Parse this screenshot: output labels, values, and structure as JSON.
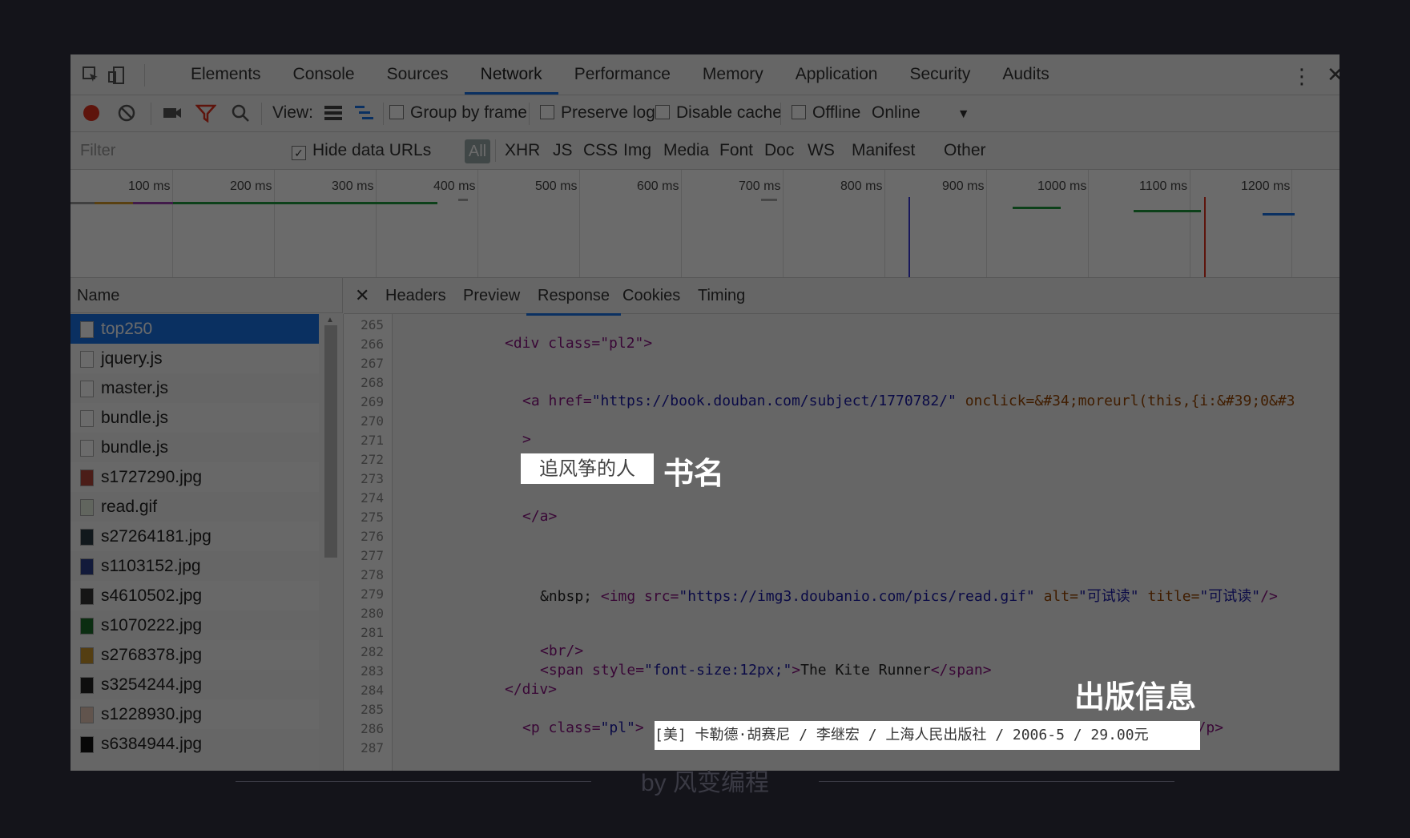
{
  "tabs": [
    "Elements",
    "Console",
    "Sources",
    "Network",
    "Performance",
    "Memory",
    "Application",
    "Security",
    "Audits"
  ],
  "toolbar": {
    "view": "View:",
    "group_by_frame": "Group by frame",
    "preserve_log": "Preserve log",
    "disable_cache": "Disable cache",
    "offline": "Offline",
    "online": "Online"
  },
  "filterbar": {
    "filter_placeholder": "Filter",
    "hide_data_urls": "Hide data URLs",
    "all": "All",
    "types": [
      "XHR",
      "JS",
      "CSS",
      "Img",
      "Media",
      "Font",
      "Doc",
      "WS",
      "Manifest",
      "Other"
    ]
  },
  "timeline": {
    "ticks": [
      "100 ms",
      "200 ms",
      "300 ms",
      "400 ms",
      "500 ms",
      "600 ms",
      "700 ms",
      "800 ms",
      "900 ms",
      "1000 ms",
      "1100 ms",
      "1200 ms"
    ]
  },
  "requests": {
    "header": "Name",
    "items": [
      "top250",
      "jquery.js",
      "master.js",
      "bundle.js",
      "bundle.js",
      "s1727290.jpg",
      "read.gif",
      "s27264181.jpg",
      "s1103152.jpg",
      "s4610502.jpg",
      "s1070222.jpg",
      "s2768378.jpg",
      "s3254244.jpg",
      "s1228930.jpg",
      "s6384944.jpg"
    ]
  },
  "detail_tabs": [
    "Headers",
    "Preview",
    "Response",
    "Cookies",
    "Timing"
  ],
  "code": {
    "line_numbers": [
      "265",
      "266",
      "267",
      "268",
      "269",
      "270",
      "271",
      "272",
      "273",
      "274",
      "275",
      "276",
      "277",
      "278",
      "279",
      "280",
      "281",
      "282",
      "283",
      "284",
      "285",
      "286",
      "287"
    ],
    "l266": "<div class=\"pl2\">",
    "l269a": "<a href=",
    "l269b": "\"https://book.douban.com/subject/1770782/\"",
    "l269c": " onclick=&#34;moreurl(this,{i:&#39;0&#3",
    "l271": ">",
    "l275": "</a>",
    "l279a": "&nbsp; ",
    "l279b": "<img src=",
    "l279c": "\"https://img3.doubanio.com/pics/read.gif\"",
    "l279d": " alt=",
    "l279e": "\"可试读\"",
    "l279f": " title=",
    "l279g": "\"可试读\"",
    "l279h": "/>",
    "l282": "<br/>",
    "l283a": "<span style=",
    "l283b": "\"font-size:12px;\"",
    "l283c": ">",
    "l283d": "The Kite Runner",
    "l283e": "</span>",
    "l284": "</div>",
    "l286a": "<p class=",
    "l286b": "\"pl\"",
    "l286c": ">",
    "l286e": "</p>"
  },
  "highlights": {
    "book_title": "追风筝的人",
    "pub_info": "[美] 卡勒德·胡赛尼 / 李继宏 / 上海人民出版社 / 2006-5 / 29.00元"
  },
  "annotations": {
    "title_label": "书名",
    "pub_label": "出版信息"
  },
  "footer": "by 风变编程"
}
